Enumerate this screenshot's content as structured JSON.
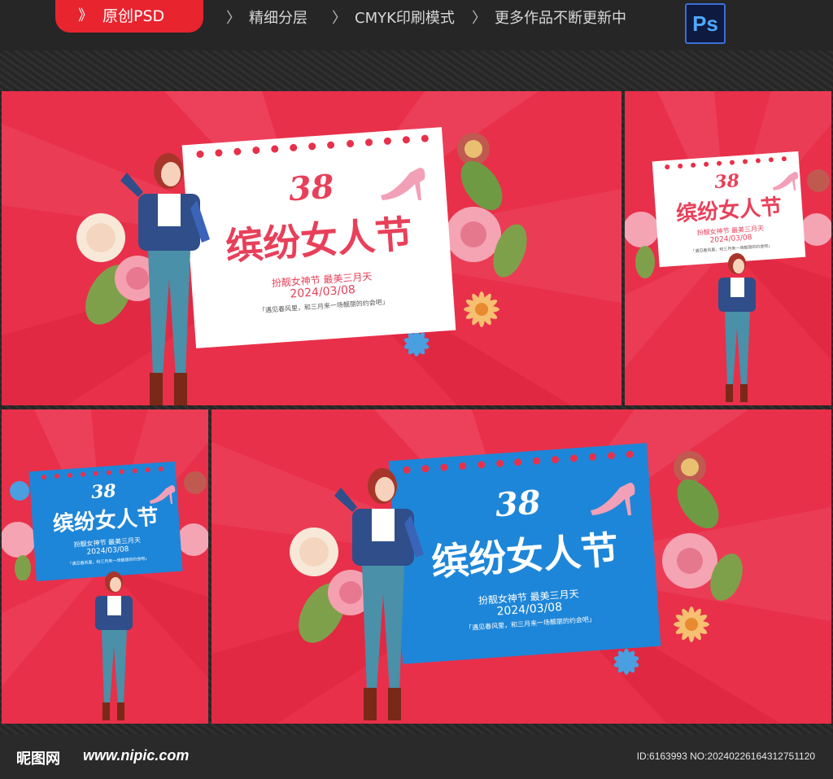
{
  "header": {
    "badge": "原创PSD",
    "features": [
      "精细分层",
      "CMYK印刷模式",
      "更多作品不断更新中"
    ],
    "ps_label": "Ps"
  },
  "poster": {
    "number": "38",
    "title": "缤纷女人节",
    "slogan": "扮靓女神节 最美三月天",
    "date": "2024/03/08",
    "quote": "「遇见春风里，和三月来一场靓丽的约会吧」"
  },
  "footer": {
    "logo": "昵图网",
    "url": "www.nipic.com",
    "image_id": "ID:6163993 NO:20240226164312751120"
  },
  "colors": {
    "background_red": "#e8304a",
    "card_white": "#ffffff",
    "card_blue": "#1e86d8",
    "title_pink": "#e8405a"
  }
}
